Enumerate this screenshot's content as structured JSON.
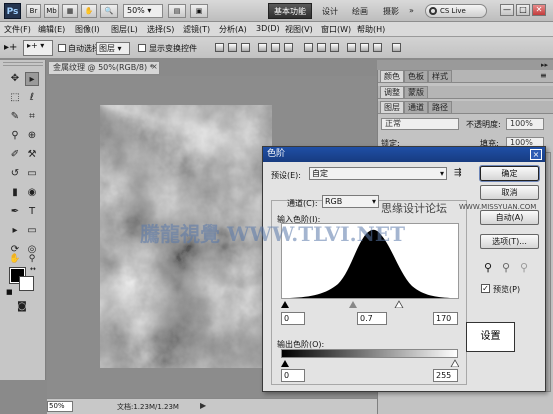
{
  "app": {
    "logo": "Ps",
    "zoom": "50%",
    "workspaces": [
      "基本功能",
      "设计",
      "绘画",
      "摄影"
    ],
    "more": "»",
    "cs_live": "CS Live",
    "window_controls": [
      "—",
      "□",
      "✕"
    ]
  },
  "menu": [
    "文件(F)",
    "编辑(E)",
    "图像(I)",
    "图层(L)",
    "选择(S)",
    "滤镜(T)",
    "分析(A)",
    "3D(D)",
    "视图(V)",
    "窗口(W)",
    "帮助(H)"
  ],
  "options": {
    "auto_select_label": "自动选择:",
    "auto_select_value": "图层",
    "show_transform_label": "显示变换控件"
  },
  "document": {
    "tab_title": "金属纹理 @ 50%(RGB/8) *",
    "close": "×",
    "zoom_field": "50%",
    "info": "文档:1.23M/1.23M",
    "status_arrow": "▶"
  },
  "panels": {
    "top_tabs": [
      "颜色",
      "色板",
      "样式"
    ],
    "adjust_tabs": [
      "调整",
      "蒙版"
    ],
    "layer_tabs": [
      "图层",
      "通道",
      "路径"
    ],
    "blend_mode": "正常",
    "opacity_label": "不透明度:",
    "opacity_value": "100%",
    "lock_label": "锁定:",
    "fill_label": "填充:",
    "fill_value": "100%"
  },
  "levels": {
    "title": "色阶",
    "close": "×",
    "preset_label": "预设(E):",
    "preset_value": "自定",
    "channel_label": "通道(C):",
    "channel_value": "RGB",
    "input_label": "输入色阶(I):",
    "input_values": [
      "0",
      "0.7",
      "170"
    ],
    "output_label": "输出色阶(O):",
    "output_values": [
      "0",
      "255"
    ],
    "buttons": {
      "ok": "确定",
      "cancel": "取消",
      "auto": "自动(A)",
      "options": "选项(T)..."
    },
    "preview_label": "预览(P)",
    "preview_checked": true
  },
  "annotation": "设置",
  "watermarks": {
    "site_cn": "思缘设计论坛",
    "site_url": "WWW.MISSYUAN.COM",
    "main": "騰龍視覺 WWW.TLVI.NET"
  }
}
